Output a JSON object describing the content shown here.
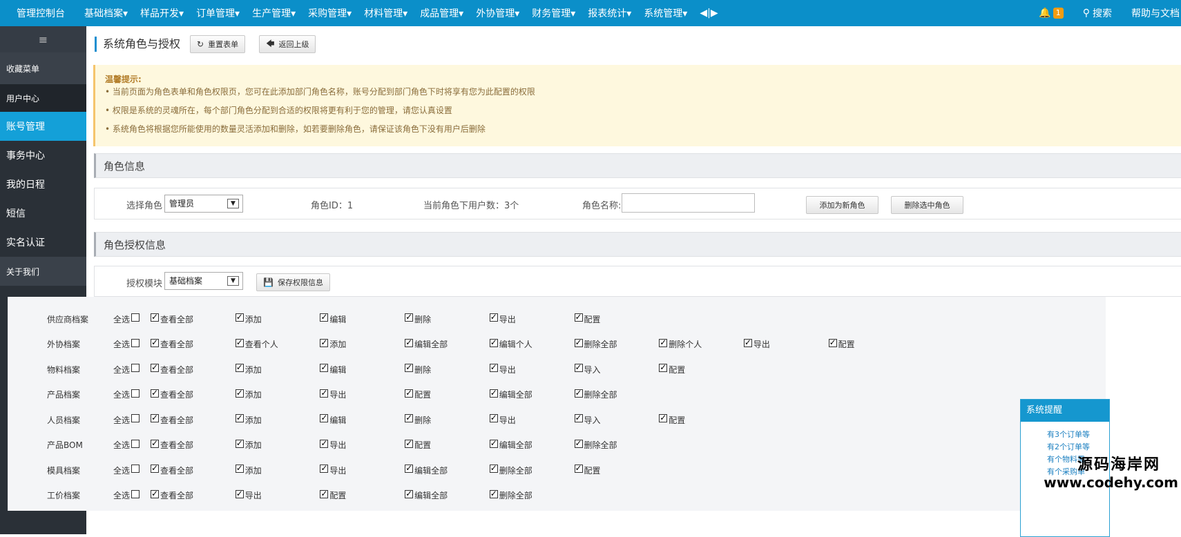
{
  "topbar": {
    "menu": [
      "管理控制台",
      "基础档案▾",
      "样品开发▾",
      "订单管理▾",
      "生产管理▾",
      "采购管理▾",
      "材料管理▾",
      "成品管理▾",
      "外协管理▾",
      "财务管理▾",
      "报表统计▾",
      "系统管理▾",
      "◀|▶"
    ],
    "notification_count": "1",
    "search_label": "搜索",
    "help_label": "帮助与文档"
  },
  "sidebar": {
    "toggle": "≡",
    "items": [
      "收藏菜单",
      "用户中心",
      "账号管理",
      "事务中心",
      "我的日程",
      "短信",
      "实名认证",
      "关于我们"
    ]
  },
  "page": {
    "title": "系统角色与授权",
    "reset_label": "重置表单",
    "back_label": "返回上级"
  },
  "notice": {
    "title": "温馨提示:",
    "lines": [
      "• 当前页面为角色表单和角色权限页，您可在此添加部门角色名称，账号分配到部门角色下时将享有您为此配置的权限",
      "• 权限是系统的灵魂所在，每个部门角色分配到合适的权限将更有利于您的管理，请您认真设置",
      "• 系统角色将根据您所能使用的数量灵活添加和删除，如若要删除角色，请保证该角色下没有用户后删除"
    ]
  },
  "role_info": {
    "section_title": "角色信息",
    "select_label": "选择角色",
    "select_value": "管理员",
    "role_id": "角色ID：1",
    "user_count": "当前角色下用户数：3个",
    "role_name_label": "角色名称:",
    "role_name_value": "",
    "add_button": "添加为新角色",
    "delete_button": "删除选中角色"
  },
  "auth_info": {
    "section_title": "角色授权信息",
    "module_label": "授权模块",
    "module_value": "基础档案",
    "save_button": "保存权限信息"
  },
  "select_all_label": "全选",
  "permissions": [
    {
      "name": "供应商档案",
      "perms": [
        "查看全部",
        "添加",
        "编辑",
        "删除",
        "导出",
        "配置"
      ]
    },
    {
      "name": "外协档案",
      "perms": [
        "查看全部",
        "查看个人",
        "添加",
        "编辑全部",
        "编辑个人",
        "删除全部",
        "删除个人",
        "导出",
        "配置"
      ]
    },
    {
      "name": "物料档案",
      "perms": [
        "查看全部",
        "添加",
        "编辑",
        "删除",
        "导出",
        "导入",
        "配置"
      ]
    },
    {
      "name": "产品档案",
      "perms": [
        "查看全部",
        "添加",
        "导出",
        "配置",
        "编辑全部",
        "删除全部"
      ]
    },
    {
      "name": "人员档案",
      "perms": [
        "查看全部",
        "添加",
        "编辑",
        "删除",
        "导出",
        "导入",
        "配置"
      ]
    },
    {
      "name": "产品BOM",
      "perms": [
        "查看全部",
        "添加",
        "导出",
        "配置",
        "编辑全部",
        "删除全部"
      ]
    },
    {
      "name": "模具档案",
      "perms": [
        "查看全部",
        "添加",
        "导出",
        "编辑全部",
        "删除全部",
        "配置"
      ]
    },
    {
      "name": "工价档案",
      "perms": [
        "查看全部",
        "导出",
        "配置",
        "编辑全部",
        "删除全部"
      ]
    }
  ],
  "reminder": {
    "title": "系统提醒",
    "lines": [
      "有3个订单等",
      "有2个订单等",
      "有个物料需",
      "有个采购单"
    ]
  },
  "watermark": {
    "line1": "源码海岸网",
    "line2": "www.codehy.com"
  },
  "colors": {
    "topbar": "#0b8fc9",
    "sidebar": "#2a3037",
    "active": "#14a0d8",
    "notice_bg": "#fef8de"
  }
}
